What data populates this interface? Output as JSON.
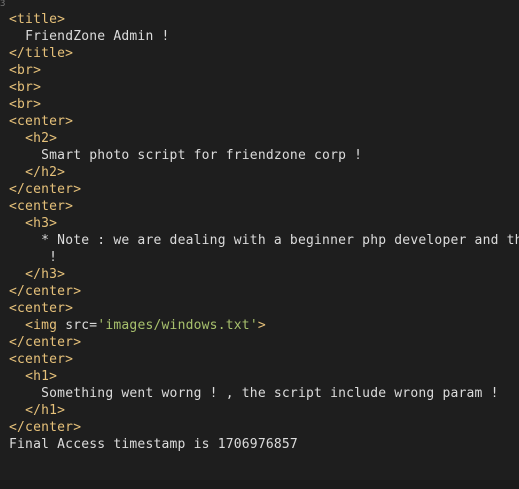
{
  "source": {
    "lines": [
      {
        "indent": "",
        "parts": [
          {
            "k": "tag",
            "t": "<title>"
          }
        ]
      },
      {
        "indent": "  ",
        "parts": [
          {
            "k": "txt",
            "t": "FriendZone Admin !"
          }
        ]
      },
      {
        "indent": "",
        "parts": [
          {
            "k": "tag",
            "t": "</title>"
          }
        ]
      },
      {
        "indent": "",
        "parts": [
          {
            "k": "tag",
            "t": "<br>"
          }
        ]
      },
      {
        "indent": "",
        "parts": [
          {
            "k": "tag",
            "t": "<br>"
          }
        ]
      },
      {
        "indent": "",
        "parts": [
          {
            "k": "tag",
            "t": "<br>"
          }
        ]
      },
      {
        "indent": "",
        "parts": [
          {
            "k": "tag",
            "t": "<center>"
          }
        ]
      },
      {
        "indent": "  ",
        "parts": [
          {
            "k": "tag",
            "t": "<h2>"
          }
        ]
      },
      {
        "indent": "    ",
        "parts": [
          {
            "k": "txt",
            "t": "Smart photo script for friendzone corp !"
          }
        ]
      },
      {
        "indent": "  ",
        "parts": [
          {
            "k": "tag",
            "t": "</h2>"
          }
        ]
      },
      {
        "indent": "",
        "parts": [
          {
            "k": "tag",
            "t": "</center>"
          }
        ]
      },
      {
        "indent": "",
        "parts": [
          {
            "k": "tag",
            "t": "<center>"
          }
        ]
      },
      {
        "indent": "  ",
        "parts": [
          {
            "k": "tag",
            "t": "<h3>"
          }
        ]
      },
      {
        "indent": "    ",
        "parts": [
          {
            "k": "txt",
            "t": "* Note : we are dealing with a beginner php developer and th"
          }
        ]
      },
      {
        "indent": "     ",
        "parts": [
          {
            "k": "txt",
            "t": "!"
          }
        ]
      },
      {
        "indent": "  ",
        "parts": [
          {
            "k": "tag",
            "t": "</h3>"
          }
        ]
      },
      {
        "indent": "",
        "parts": [
          {
            "k": "tag",
            "t": "</center>"
          }
        ]
      },
      {
        "indent": "",
        "parts": [
          {
            "k": "tag",
            "t": "<center>"
          }
        ]
      },
      {
        "indent": "  ",
        "parts": [
          {
            "k": "tag",
            "t": "<img "
          },
          {
            "k": "attr",
            "t": "src="
          },
          {
            "k": "str",
            "t": "'images/windows.txt'"
          },
          {
            "k": "tag",
            "t": ">"
          }
        ]
      },
      {
        "indent": "",
        "parts": [
          {
            "k": "tag",
            "t": "</center>"
          }
        ]
      },
      {
        "indent": "",
        "parts": [
          {
            "k": "tag",
            "t": "<center>"
          }
        ]
      },
      {
        "indent": "  ",
        "parts": [
          {
            "k": "tag",
            "t": "<h1>"
          }
        ]
      },
      {
        "indent": "    ",
        "parts": [
          {
            "k": "txt",
            "t": "Something went worng ! , the script include wrong param !"
          }
        ]
      },
      {
        "indent": "  ",
        "parts": [
          {
            "k": "tag",
            "t": "</h1>"
          }
        ]
      },
      {
        "indent": "",
        "parts": [
          {
            "k": "tag",
            "t": "</center>"
          }
        ]
      },
      {
        "indent": "",
        "parts": [
          {
            "k": "txt",
            "t": "Final Access timestamp is 1706976857"
          }
        ]
      }
    ]
  },
  "colors": {
    "background": "#1e1e1e",
    "tag": "#e6c17a",
    "string": "#a8c16d",
    "text": "#dcdcdc"
  }
}
